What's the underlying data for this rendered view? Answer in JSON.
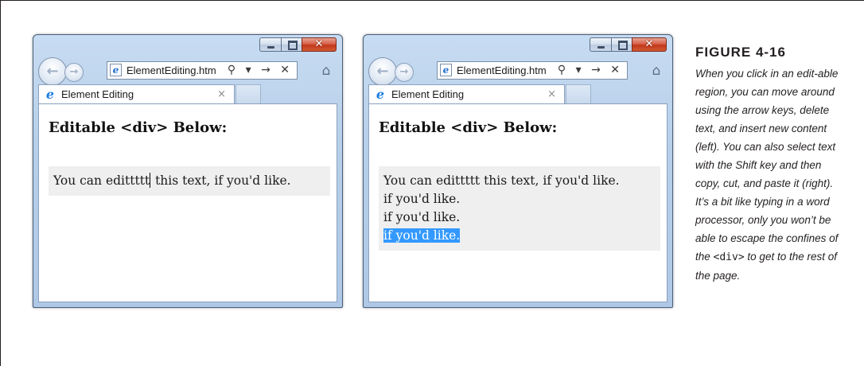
{
  "figure": {
    "label": "FIGURE 4-16",
    "caption_part1": "When you click in an edit-able region, you can move around using the arrow keys, delete text, and insert new content (left). You can also select text with the Shift key and then copy, cut, and paste it (right). It’s a bit like typing in a word processor, only you won’t be able to escape the confines of the ",
    "caption_code": "<div>",
    "caption_part2": " to get to the rest of the page."
  },
  "browser": {
    "address_text": "ElementEditing.htm",
    "address_tools": "⚲ ▾ → ✕",
    "tab_label": "Element Editing",
    "tab_close": "×",
    "home_icon": "⌂",
    "ie_icon_glyph": "e",
    "back_glyph": "←",
    "forward_glyph": "→",
    "close_glyph": "✕"
  },
  "left_window": {
    "heading": "Editable <div> Below:",
    "text_before_caret": "You can edittttt",
    "text_after_caret": " this text, if you'd like."
  },
  "right_window": {
    "heading": "Editable <div> Below:",
    "line1": "You can edittttt this text, if you'd like.",
    "line2": "if you'd like.",
    "line3": "if you'd like.",
    "line4_selected": "if you'd like."
  },
  "colors": {
    "selection": "#3399ff",
    "editable_background": "#efefef",
    "window_frame": "#b7cfe9"
  }
}
